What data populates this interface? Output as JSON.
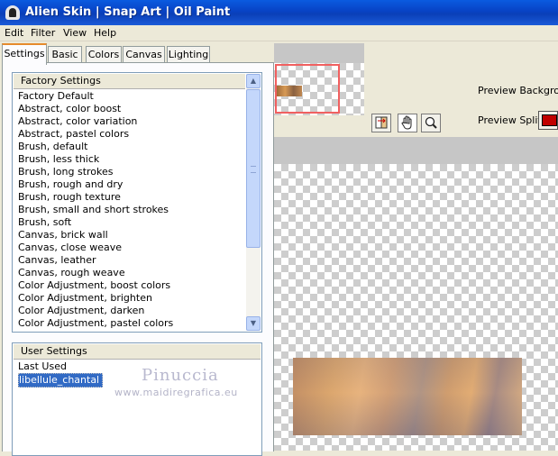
{
  "window": {
    "title": "Alien Skin | Snap Art | Oil Paint",
    "icon": "alien-skin-logo-icon"
  },
  "menu": {
    "items": [
      "Edit",
      "Filter",
      "View",
      "Help"
    ]
  },
  "tabs": [
    {
      "label": "Settings",
      "active": true
    },
    {
      "label": "Basic",
      "active": false
    },
    {
      "label": "Colors",
      "active": false
    },
    {
      "label": "Canvas",
      "active": false
    },
    {
      "label": "Lighting",
      "active": false
    }
  ],
  "factory_settings": {
    "header": "Factory Settings",
    "items": [
      "Factory Default",
      "Abstract, color boost",
      "Abstract, color variation",
      "Abstract, pastel colors",
      "Brush, default",
      "Brush, less thick",
      "Brush, long strokes",
      "Brush, rough and dry",
      "Brush, rough texture",
      "Brush, small and short strokes",
      "Brush, soft",
      "Canvas, brick wall",
      "Canvas, close weave",
      "Canvas, leather",
      "Canvas, rough weave",
      "Color Adjustment, boost colors",
      "Color Adjustment, brighten",
      "Color Adjustment, darken",
      "Color Adjustment, pastel colors"
    ]
  },
  "user_settings": {
    "header": "User Settings",
    "items": [
      "Last Used",
      "libellule_chantal"
    ],
    "selected": "libellule_chantal"
  },
  "watermark": {
    "name": "Pinuccia",
    "url": "www.maidiregrafica.eu"
  },
  "preview": {
    "background_label": "Preview Backgrou",
    "split_label": "Preview Split:",
    "split_color": "#c00000",
    "tools": [
      "compare-icon",
      "hand-icon",
      "zoom-icon"
    ]
  },
  "colors": {
    "titlebar": "#0a47cc",
    "selection": "#316ac5",
    "active_tab_accent": "#e68b2c",
    "navigator_frame": "#f06060"
  }
}
